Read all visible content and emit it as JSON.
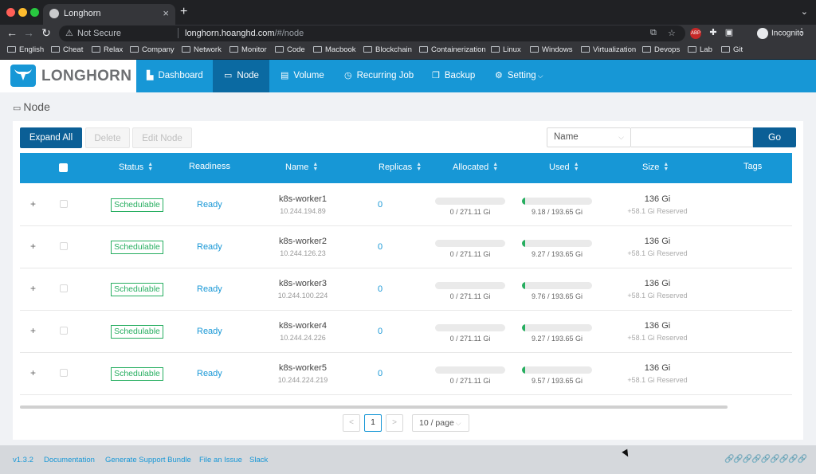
{
  "browser": {
    "tab_title": "Longhorn",
    "new_tab": "+",
    "security_label": "Not Secure",
    "url_host": "longhorn.hoanghd.com",
    "url_path": "/#/node",
    "incognito_label": "Incognito",
    "extensions": [
      {
        "name": "abp-extension-icon",
        "label": "ABP",
        "color": "#c62828"
      },
      {
        "name": "puzzle-extension-icon",
        "label": "",
        "color": "#5f6368"
      }
    ],
    "bookmarks": [
      "English",
      "Cheat",
      "Relax",
      "Company",
      "Network",
      "Monitor",
      "Code",
      "Macbook",
      "Blockchain",
      "Containerization",
      "Linux",
      "Windows",
      "Virtualization",
      "Devops",
      "Lab",
      "Git"
    ]
  },
  "app": {
    "brand": "LONGHORN",
    "accent_color": "#1797d6",
    "nav": [
      {
        "label": "Dashboard",
        "icon": "chart-icon",
        "active": false
      },
      {
        "label": "Node",
        "icon": "laptop-icon",
        "active": true
      },
      {
        "label": "Volume",
        "icon": "database-icon",
        "active": false
      },
      {
        "label": "Recurring Job",
        "icon": "clock-icon",
        "active": false
      },
      {
        "label": "Backup",
        "icon": "backup-icon",
        "active": false
      },
      {
        "label": "Setting",
        "icon": "gear-icon",
        "active": false
      }
    ]
  },
  "page": {
    "title": "Node",
    "buttons": {
      "expand_all": "Expand All",
      "delete": "Delete",
      "edit_node": "Edit Node"
    },
    "search": {
      "field_select": "Name",
      "placeholder": "",
      "go": "Go"
    }
  },
  "table": {
    "columns": [
      "Status",
      "Readiness",
      "Name",
      "Replicas",
      "Allocated",
      "Used",
      "Size",
      "Tags"
    ],
    "rows": [
      {
        "status": "Schedulable",
        "readiness": "Ready",
        "name": "k8s-worker1",
        "ip": "10.244.194.89",
        "replicas": "0",
        "allocated": "0 / 271.11 Gi",
        "allocated_pct": 0,
        "used": "9.18 / 193.65 Gi",
        "used_pct": 4.7,
        "size": "136 Gi",
        "reserved": "+58.1 Gi Reserved"
      },
      {
        "status": "Schedulable",
        "readiness": "Ready",
        "name": "k8s-worker2",
        "ip": "10.244.126.23",
        "replicas": "0",
        "allocated": "0 / 271.11 Gi",
        "allocated_pct": 0,
        "used": "9.27 / 193.65 Gi",
        "used_pct": 4.8,
        "size": "136 Gi",
        "reserved": "+58.1 Gi Reserved"
      },
      {
        "status": "Schedulable",
        "readiness": "Ready",
        "name": "k8s-worker3",
        "ip": "10.244.100.224",
        "replicas": "0",
        "allocated": "0 / 271.11 Gi",
        "allocated_pct": 0,
        "used": "9.76 / 193.65 Gi",
        "used_pct": 5.0,
        "size": "136 Gi",
        "reserved": "+58.1 Gi Reserved"
      },
      {
        "status": "Schedulable",
        "readiness": "Ready",
        "name": "k8s-worker4",
        "ip": "10.244.24.226",
        "replicas": "0",
        "allocated": "0 / 271.11 Gi",
        "allocated_pct": 0,
        "used": "9.27 / 193.65 Gi",
        "used_pct": 4.8,
        "size": "136 Gi",
        "reserved": "+58.1 Gi Reserved"
      },
      {
        "status": "Schedulable",
        "readiness": "Ready",
        "name": "k8s-worker5",
        "ip": "10.244.224.219",
        "replicas": "0",
        "allocated": "0 / 271.11 Gi",
        "allocated_pct": 0,
        "used": "9.57 / 193.65 Gi",
        "used_pct": 4.9,
        "size": "136 Gi",
        "reserved": "+58.1 Gi Reserved"
      }
    ]
  },
  "pagination": {
    "prev": "<",
    "current": "1",
    "next": ">",
    "page_size": "10 / page"
  },
  "footer": {
    "links": [
      "v1.3.2",
      "Documentation",
      "Generate Support Bundle",
      "File an Issue",
      "Slack"
    ]
  }
}
